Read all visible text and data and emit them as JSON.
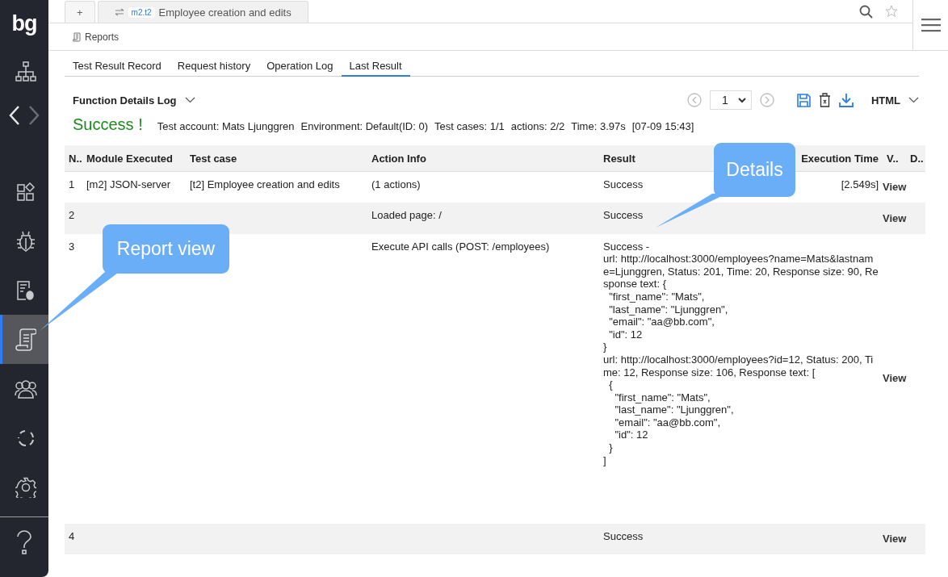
{
  "sidebar": {
    "logo": "bg",
    "items": [
      {
        "selected": false
      },
      {
        "selected": false
      },
      {
        "selected": false
      },
      {
        "selected": false
      },
      {
        "selected": true
      },
      {
        "selected": false
      },
      {
        "selected": false
      },
      {
        "selected": false
      }
    ]
  },
  "tabs": [
    {
      "label": "+",
      "selected": false
    },
    {
      "badge": "m2.t2",
      "label": "Employee creation and edits",
      "selected": true
    }
  ],
  "breadcrumb": "Reports",
  "subtabs": [
    {
      "label": "Test Result Record",
      "selected": false
    },
    {
      "label": "Request history",
      "selected": false
    },
    {
      "label": "Operation Log",
      "selected": false
    },
    {
      "label": "Last Result",
      "selected": true
    }
  ],
  "toolbar": {
    "title": "Function Details Log",
    "page": "1",
    "format": "HTML"
  },
  "summary": {
    "status": "Success !",
    "items": [
      "Test account: Mats Ljunggren",
      "Environment: Default(ID: 0)",
      "Test cases: 1/1",
      "actions: 2/2",
      "Time: 3.97s",
      "[07-09 15:43]"
    ]
  },
  "table": {
    "columns": [
      "N..",
      "Module Executed",
      "Test case",
      "Action Info",
      "Result",
      "Execution Time",
      "V..",
      "D.."
    ],
    "rows": [
      {
        "n": "1",
        "module": "[m2] JSON-server",
        "test_case": "[t2] Employee creation and edits",
        "action": "(1 actions)",
        "result": "Success",
        "time": "[2.549s]",
        "view": "View"
      },
      {
        "n": "2",
        "action": "Loaded page: /",
        "result": "Success",
        "view": "View"
      },
      {
        "n": "3",
        "action": "Execute API calls (POST: /employees)",
        "result": "Success -\nurl: http://localhost:3000/employees?name=Mats&lastname=Ljunggren, Status: 201, Time: 20, Response size: 90, Response text: {\n  \"first_name\": \"Mats\",\n  \"last_name\": \"Ljunggren\",\n  \"email\": \"aa@bb.com\",\n  \"id\": 12\n}\nurl: http://localhost:3000/employees?id=12, Status: 200, Time: 12, Response size: 106, Response text: [\n  {\n    \"first_name\": \"Mats\",\n    \"last_name\": \"Ljunggren\",\n    \"email\": \"aa@bb.com\",\n    \"id\": 12\n  }\n]",
        "view": "View"
      },
      {
        "n": "4",
        "result": "Success",
        "view": "View"
      }
    ]
  },
  "callouts": [
    {
      "kind": "sidebar",
      "text": "Report view"
    },
    {
      "kind": "details",
      "text": "Details"
    }
  ]
}
